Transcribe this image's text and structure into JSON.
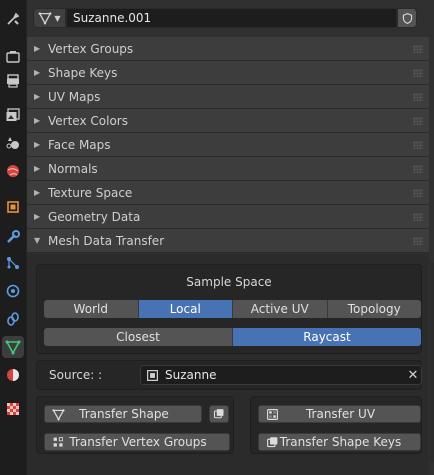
{
  "tabs": [
    {
      "icon": "tool-icon"
    },
    {
      "icon": "render-icon"
    },
    {
      "icon": "output-icon"
    },
    {
      "icon": "view-layer-icon"
    },
    {
      "icon": "scene-icon"
    },
    {
      "icon": "world-icon"
    },
    {
      "icon": "object-icon"
    },
    {
      "icon": "modifier-icon"
    },
    {
      "icon": "particles-icon"
    },
    {
      "icon": "physics-icon"
    },
    {
      "icon": "constraints-icon"
    },
    {
      "icon": "mesh-data-icon",
      "active": true
    },
    {
      "icon": "material-icon"
    },
    {
      "icon": "texture-icon"
    }
  ],
  "datablock": {
    "name": "Suzanne.001",
    "type_icon": "mesh-data-icon",
    "fake_user_icon": "shield-icon"
  },
  "panels": {
    "vertex_groups": "Vertex Groups",
    "shape_keys": "Shape Keys",
    "uv_maps": "UV Maps",
    "vertex_colors": "Vertex Colors",
    "face_maps": "Face Maps",
    "normals": "Normals",
    "texture_space": "Texture Space",
    "geometry_data": "Geometry Data",
    "mesh_data_transfer": "Mesh Data Transfer"
  },
  "mesh_data_transfer": {
    "sample_space_title": "Sample Space",
    "sample_space": [
      "World",
      "Local",
      "Active UV",
      "Topology"
    ],
    "sample_space_selected": "Local",
    "search_method": [
      "Closest",
      "Raycast"
    ],
    "search_method_selected": "Raycast",
    "source_label": "Source: :",
    "source_value": "Suzanne",
    "buttons": {
      "transfer_shape": "Transfer Shape",
      "transfer_vertex_groups": "Transfer Vertex Groups",
      "transfer_uv": "Transfer UV",
      "transfer_shape_keys": "Transfer Shape Keys"
    }
  },
  "colors": {
    "accent": "#4772b3",
    "panel_header": "#3d3d3d",
    "background": "#303030"
  }
}
